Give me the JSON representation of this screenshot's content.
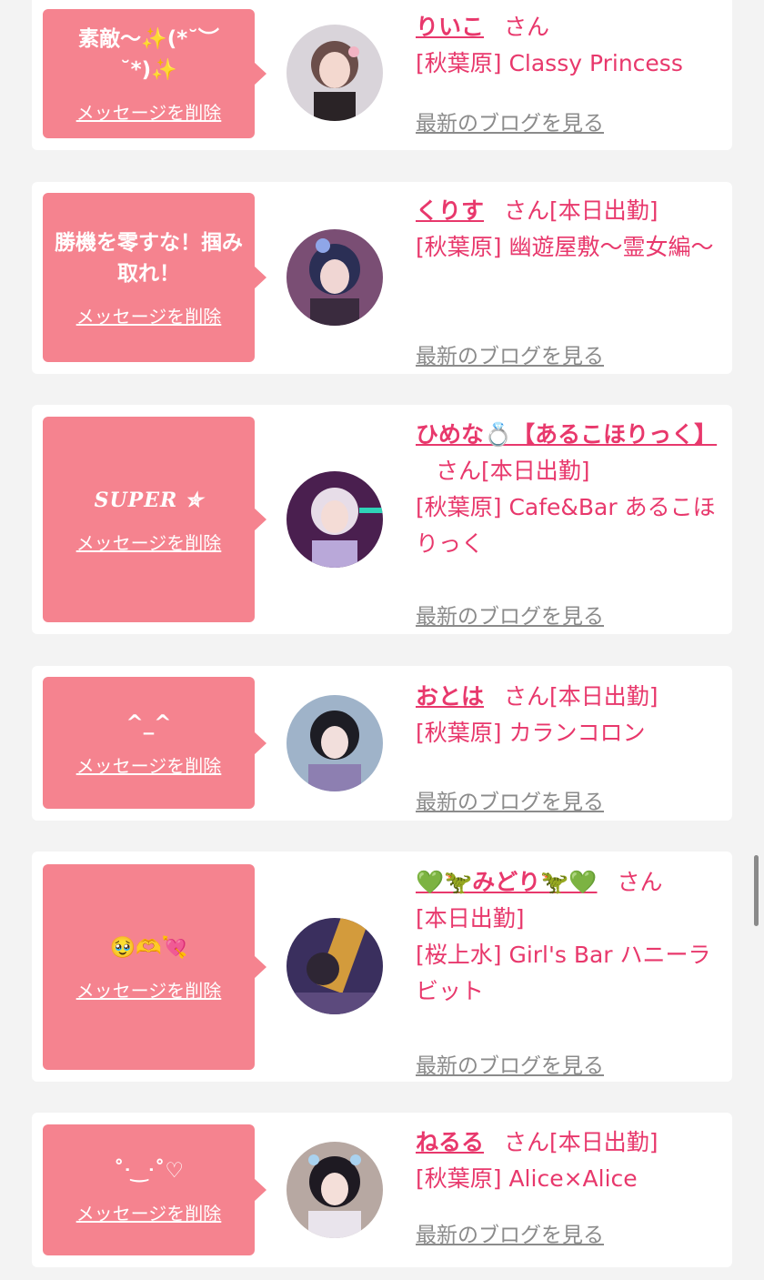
{
  "colors": {
    "accent": "#e8386c",
    "bubble": "#f5838f",
    "muted": "#8b8b8b",
    "background": "#f3f3f3"
  },
  "delete_label": "メッセージを削除",
  "blog_label": "最新のブログを見る",
  "honorific": "さん",
  "entries": [
    {
      "message": "素敵〜✨(*˘︶˘*)✨",
      "name": "りいこ",
      "status": "",
      "shop": "[秋葉原] Classy Princess",
      "avatar_icon": "photo-icon"
    },
    {
      "message": "勝機を零すな！掴み取れ！",
      "name": "くりす",
      "status": "[本日出勤]",
      "shop": "[秋葉原] 幽遊屋敷〜霊女編〜",
      "avatar_icon": "photo-icon"
    },
    {
      "message": "SUPER ✮",
      "name": "ひめな💍【あるこほりっく】",
      "status": "[本日出勤]",
      "shop": "[秋葉原] Cafe&Bar あるこほりっく",
      "avatar_icon": "photo-icon"
    },
    {
      "message": "^_^",
      "name": "おとは",
      "status": "[本日出勤]",
      "shop": "[秋葉原] カランコロン",
      "avatar_icon": "photo-icon"
    },
    {
      "message": "🥹🫶💘",
      "name": "💚🦖みどり🦖💚",
      "status": "[本日出勤]",
      "shop": "[桜上水] Girl's Bar ハニーラビット",
      "avatar_icon": "photo-icon"
    },
    {
      "message": "˚ᐧ‿ᐧ˚♡",
      "name": "ねるる",
      "status": "[本日出勤]",
      "shop": "[秋葉原] Alice×Alice",
      "avatar_icon": "photo-icon"
    }
  ]
}
